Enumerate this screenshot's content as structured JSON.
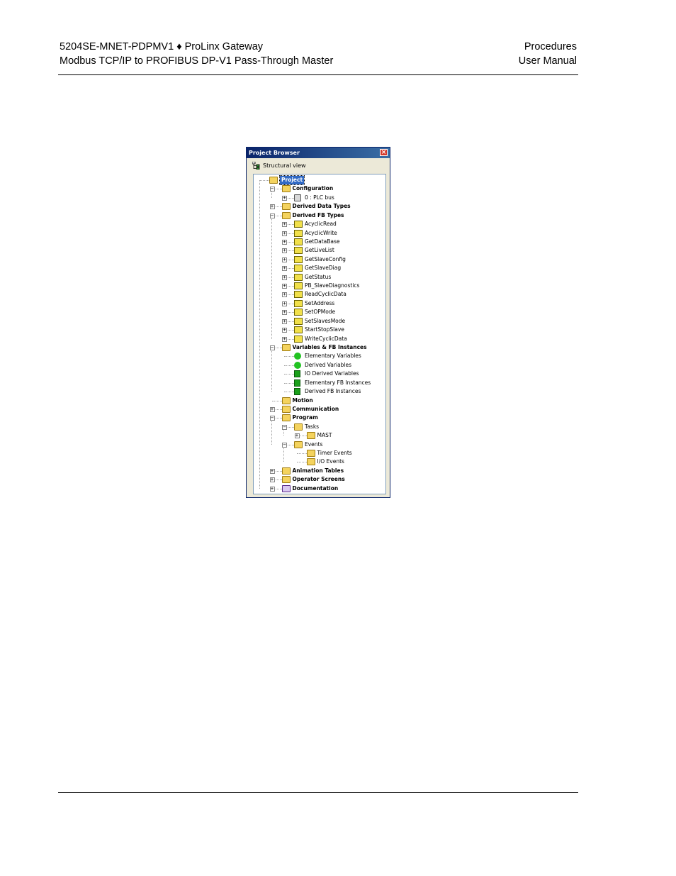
{
  "header": {
    "left_line1": "5204SE-MNET-PDPMV1 ♦ ProLinx Gateway",
    "left_line2": "Modbus TCP/IP to PROFIBUS DP-V1 Pass-Through Master",
    "right_line1": "Procedures",
    "right_line2": "User Manual"
  },
  "window": {
    "title": "Project Browser",
    "close_glyph": "×",
    "view_label": "Structural view"
  },
  "tree": [
    {
      "label": "Project",
      "level": 0,
      "toggle": "",
      "icon": "folder-open-icon",
      "bold": true,
      "selected": true
    },
    {
      "label": "Configuration",
      "level": 1,
      "toggle": "−",
      "icon": "folder-open-icon",
      "bold": true
    },
    {
      "label": "0 : PLC bus",
      "level": 2,
      "toggle": "+",
      "icon": "plc-bus-icon"
    },
    {
      "label": "Derived Data Types",
      "level": 1,
      "toggle": "+",
      "icon": "folder-icon",
      "bold": true
    },
    {
      "label": "Derived FB Types",
      "level": 1,
      "toggle": "−",
      "icon": "folder-open-icon",
      "bold": true
    },
    {
      "label": "AcyclicRead",
      "level": 2,
      "toggle": "+",
      "icon": "fb-type-icon"
    },
    {
      "label": "AcyclicWrite",
      "level": 2,
      "toggle": "+",
      "icon": "fb-type-icon"
    },
    {
      "label": "GetDataBase",
      "level": 2,
      "toggle": "+",
      "icon": "fb-type-icon"
    },
    {
      "label": "GetLiveList",
      "level": 2,
      "toggle": "+",
      "icon": "fb-type-icon"
    },
    {
      "label": "GetSlaveConfig",
      "level": 2,
      "toggle": "+",
      "icon": "fb-type-icon"
    },
    {
      "label": "GetSlaveDiag",
      "level": 2,
      "toggle": "+",
      "icon": "fb-type-icon"
    },
    {
      "label": "GetStatus",
      "level": 2,
      "toggle": "+",
      "icon": "fb-type-icon"
    },
    {
      "label": "PB_SlaveDiagnostics",
      "level": 2,
      "toggle": "+",
      "icon": "fb-type-icon"
    },
    {
      "label": "ReadCyclicData",
      "level": 2,
      "toggle": "+",
      "icon": "fb-type-icon"
    },
    {
      "label": "SetAddress",
      "level": 2,
      "toggle": "+",
      "icon": "fb-type-icon"
    },
    {
      "label": "SetOPMode",
      "level": 2,
      "toggle": "+",
      "icon": "fb-type-icon"
    },
    {
      "label": "SetSlavesMode",
      "level": 2,
      "toggle": "+",
      "icon": "fb-type-icon"
    },
    {
      "label": "StartStopSlave",
      "level": 2,
      "toggle": "+",
      "icon": "fb-type-icon"
    },
    {
      "label": "WriteCyclicData",
      "level": 2,
      "toggle": "+",
      "icon": "fb-type-icon"
    },
    {
      "label": "Variables & FB Instances",
      "level": 1,
      "toggle": "−",
      "icon": "folder-open-icon",
      "bold": true
    },
    {
      "label": "Elementary Variables",
      "level": 2,
      "toggle": "",
      "icon": "elementary-variables-icon"
    },
    {
      "label": "Derived Variables",
      "level": 2,
      "toggle": "",
      "icon": "derived-variables-icon"
    },
    {
      "label": "IO Derived Variables",
      "level": 2,
      "toggle": "",
      "icon": "io-derived-variables-icon"
    },
    {
      "label": "Elementary FB Instances",
      "level": 2,
      "toggle": "",
      "icon": "elementary-fb-instances-icon"
    },
    {
      "label": "Derived FB Instances",
      "level": 2,
      "toggle": "",
      "icon": "derived-fb-instances-icon"
    },
    {
      "label": "Motion",
      "level": 1,
      "toggle": "",
      "icon": "folder-icon",
      "bold": true
    },
    {
      "label": "Communication",
      "level": 1,
      "toggle": "+",
      "icon": "folder-icon",
      "bold": true
    },
    {
      "label": "Program",
      "level": 1,
      "toggle": "−",
      "icon": "folder-open-icon",
      "bold": true
    },
    {
      "label": "Tasks",
      "level": 2,
      "toggle": "−",
      "icon": "folder-open-icon"
    },
    {
      "label": "MAST",
      "level": 3,
      "toggle": "+",
      "icon": "folder-icon"
    },
    {
      "label": "Events",
      "level": 2,
      "toggle": "−",
      "icon": "folder-open-icon"
    },
    {
      "label": "Timer Events",
      "level": 3,
      "toggle": "",
      "icon": "folder-icon"
    },
    {
      "label": "I/O Events",
      "level": 3,
      "toggle": "",
      "icon": "folder-icon"
    },
    {
      "label": "Animation Tables",
      "level": 1,
      "toggle": "+",
      "icon": "folder-icon",
      "bold": true
    },
    {
      "label": "Operator Screens",
      "level": 1,
      "toggle": "+",
      "icon": "folder-icon",
      "bold": true
    },
    {
      "label": "Documentation",
      "level": 1,
      "toggle": "+",
      "icon": "documentation-icon",
      "bold": true
    }
  ]
}
